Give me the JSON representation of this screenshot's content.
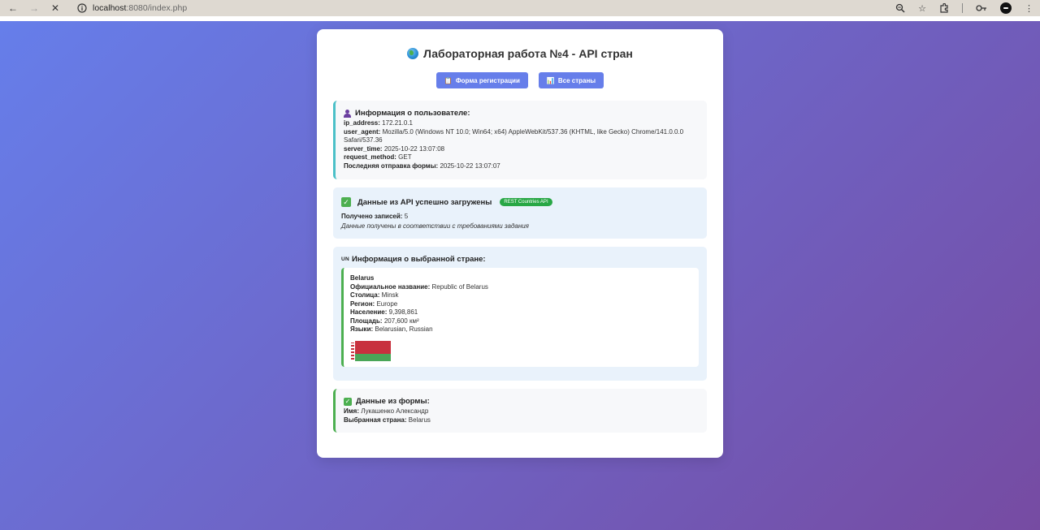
{
  "browser": {
    "url_host": "localhost",
    "url_path": ":8080/index.php"
  },
  "page": {
    "title": "Лабораторная работа №4 - API стран",
    "buttons": {
      "register": "Форма регистрации",
      "countries": "Все страны"
    }
  },
  "user_info": {
    "heading": "Информация о пользователе:",
    "ip_label": "ip_address:",
    "ip_value": "172.21.0.1",
    "ua_label": "user_agent:",
    "ua_value": "Mozilla/5.0 (Windows NT 10.0; Win64; x64) AppleWebKit/537.36 (KHTML, like Gecko) Chrome/141.0.0.0 Safari/537.36",
    "time_label": "server_time:",
    "time_value": "2025-10-22 13:07:08",
    "method_label": "request_method:",
    "method_value": "GET",
    "last_label": "Последняя отправка формы:",
    "last_value": "2025-10-22 13:07:07"
  },
  "api": {
    "heading": "Данные из API успешно загружены",
    "badge": "REST Countries API",
    "count_label": "Получено записей:",
    "count_value": "5",
    "note": "Данные получены в соответствии с требованиями задания"
  },
  "country": {
    "icon_text": "UN",
    "heading": "Информация о выбранной стране:",
    "name": "Belarus",
    "official_label": "Официальное название:",
    "official_value": "Republic of Belarus",
    "capital_label": "Столица:",
    "capital_value": "Minsk",
    "region_label": "Регион:",
    "region_value": "Europe",
    "population_label": "Население:",
    "population_value": "9,398,861",
    "area_label": "Площадь:",
    "area_value": "207,600 км²",
    "languages_label": "Языки:",
    "languages_value": "Belarusian, Russian",
    "flag_colors": {
      "red": "#c8313e",
      "green": "#4aa657",
      "white": "#ffffff"
    }
  },
  "form": {
    "heading": "Данные из формы:",
    "name_label": "Имя:",
    "name_value": "Лукашенко Александр",
    "country_label": "Выбранная страна:",
    "country_value": "Belarus"
  },
  "colors": {
    "gradient_start": "#667eea",
    "gradient_end": "#764ba2",
    "button": "#667eea",
    "success": "#4caf50",
    "badge": "#28a745",
    "info_border": "#4bc0c8"
  }
}
